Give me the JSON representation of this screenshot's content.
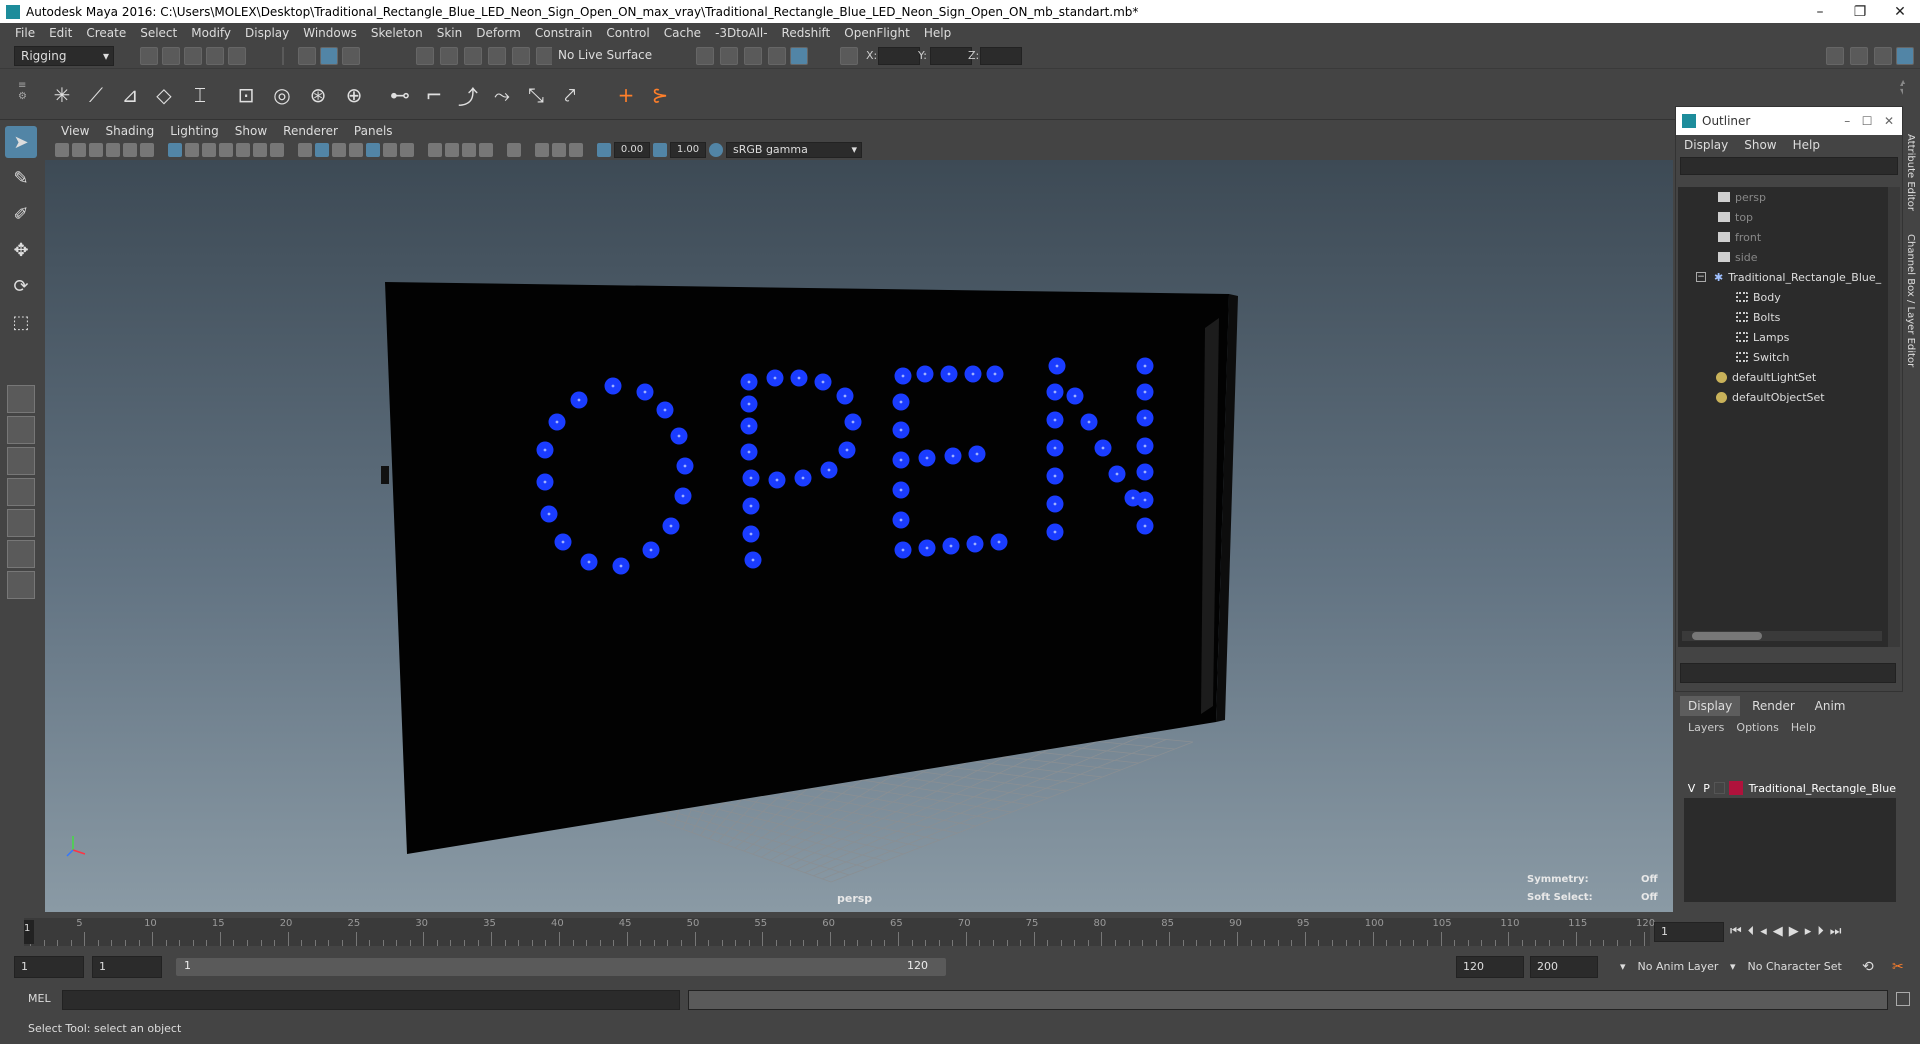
{
  "window": {
    "title": "Autodesk Maya 2016: C:\\Users\\MOLEX\\Desktop\\Traditional_Rectangle_Blue_LED_Neon_Sign_Open_ON_max_vray\\Traditional_Rectangle_Blue_LED_Neon_Sign_Open_ON_mb_standart.mb*",
    "min": "–",
    "restore": "❐",
    "close": "✕"
  },
  "menubar": [
    "File",
    "Edit",
    "Create",
    "Select",
    "Modify",
    "Display",
    "Windows",
    "Skeleton",
    "Skin",
    "Deform",
    "Constrain",
    "Control",
    "Cache",
    "-3DtoAll-",
    "Redshift",
    "OpenFlight",
    "Help"
  ],
  "statusline": {
    "mode": "Rigging",
    "live_surface": "No Live Surface",
    "x_label": "X:",
    "y_label": "Y:",
    "z_label": "Z:"
  },
  "viewport": {
    "menus": [
      "View",
      "Shading",
      "Lighting",
      "Show",
      "Renderer",
      "Panels"
    ],
    "exposure": "0.00",
    "gamma": "1.00",
    "color_space": "sRGB gamma",
    "camera_label": "persp",
    "symmetry_label": "Symmetry:",
    "symmetry_value": "Off",
    "soft_select_label": "Soft Select:",
    "soft_select_value": "Off",
    "led_color": "#1a3cff"
  },
  "outliner": {
    "title": "Outliner",
    "menus": [
      "Display",
      "Show",
      "Help"
    ],
    "items": [
      {
        "label": "persp",
        "icon": "camera-icon",
        "dim": true
      },
      {
        "label": "top",
        "icon": "camera-icon",
        "dim": true
      },
      {
        "label": "front",
        "icon": "camera-icon",
        "dim": true
      },
      {
        "label": "side",
        "icon": "camera-icon",
        "dim": true
      },
      {
        "label": "Traditional_Rectangle_Blue_",
        "icon": "transform-icon",
        "dim": false
      },
      {
        "label": "Body",
        "icon": "mesh-icon",
        "dim": false
      },
      {
        "label": "Bolts",
        "icon": "mesh-icon",
        "dim": false
      },
      {
        "label": "Lamps",
        "icon": "mesh-icon",
        "dim": false
      },
      {
        "label": "Switch",
        "icon": "mesh-icon",
        "dim": false
      },
      {
        "label": "defaultLightSet",
        "icon": "set-icon",
        "dim": false
      },
      {
        "label": "defaultObjectSet",
        "icon": "set-icon",
        "dim": false
      }
    ]
  },
  "layer_editor": {
    "tabs": [
      "Display",
      "Render",
      "Anim"
    ],
    "menus": [
      "Layers",
      "Options",
      "Help"
    ],
    "layer": {
      "v": "V",
      "p": "P",
      "name": "Traditional_Rectangle_Blue",
      "color": "#b0123c"
    }
  },
  "side_tabs": [
    "Attribute Editor",
    "Channel Box / Layer Editor"
  ],
  "timeline": {
    "ticks": [
      "5",
      "10",
      "15",
      "20",
      "25",
      "30",
      "35",
      "40",
      "45",
      "50",
      "55",
      "60",
      "65",
      "70",
      "75",
      "80",
      "85",
      "90",
      "95",
      "100",
      "105",
      "110",
      "115",
      "120"
    ],
    "current_frame_marker": "1",
    "current_frame": "1"
  },
  "range": {
    "start": "1",
    "playback_start": "1",
    "slider_start": "1",
    "slider_end": "120",
    "playback_end": "120",
    "end": "200",
    "anim_layer": "No Anim Layer",
    "character_set": "No Character Set"
  },
  "cmdline": {
    "label": "MEL"
  },
  "helpline": {
    "text": "Select Tool: select an object"
  }
}
